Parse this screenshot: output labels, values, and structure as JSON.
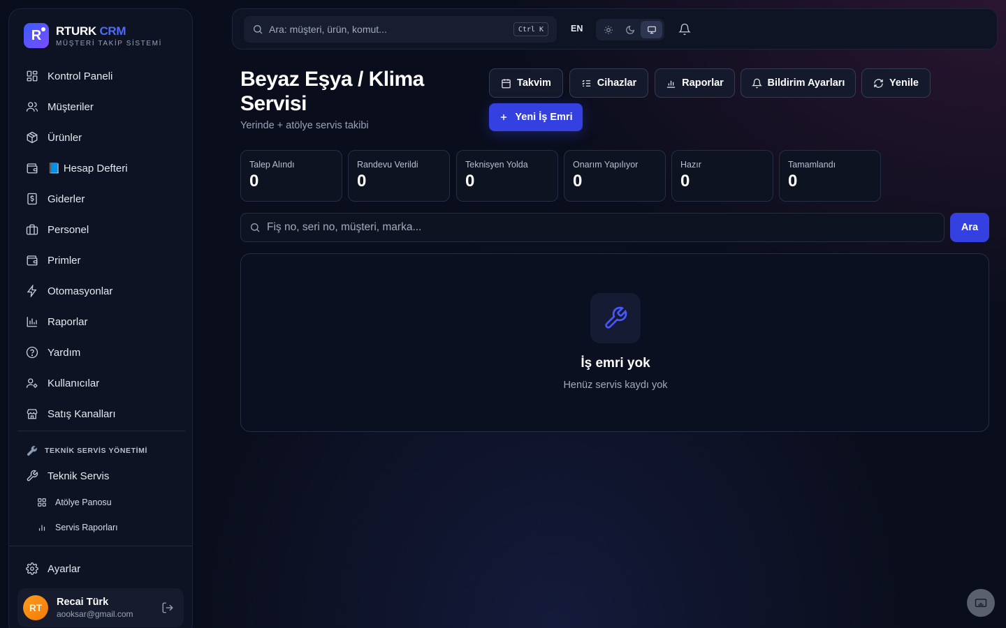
{
  "brand": {
    "title_a": "RTURK",
    "title_b": "CRM",
    "subtitle": "MÜŞTERİ TAKİP SİSTEMİ",
    "logo_letter": "R"
  },
  "sidebar": {
    "items": [
      {
        "label": "Kontrol Paneli",
        "icon": "grid-icon"
      },
      {
        "label": "Müşteriler",
        "icon": "users-icon"
      },
      {
        "label": "Ürünler",
        "icon": "box-icon"
      },
      {
        "label": "📘 Hesap Defteri",
        "icon": "wallet-icon"
      },
      {
        "label": "Giderler",
        "icon": "receipt-icon"
      },
      {
        "label": "Personel",
        "icon": "briefcase-icon"
      },
      {
        "label": "Primler",
        "icon": "wallet-icon"
      },
      {
        "label": "Otomasyonlar",
        "icon": "bolt-icon"
      },
      {
        "label": "Raporlar",
        "icon": "chart-icon"
      },
      {
        "label": "Yardım",
        "icon": "help-icon"
      },
      {
        "label": "Kullanıcılar",
        "icon": "user-cog-icon"
      },
      {
        "label": "Satış Kanalları",
        "icon": "store-icon"
      }
    ],
    "section_label": "TEKNİK SERVİS YÖNETİMİ",
    "section_item": "Teknik Servis",
    "sub_items": [
      {
        "label": "Atölye Panosu"
      },
      {
        "label": "Servis Raporları"
      }
    ],
    "settings": "Ayarlar",
    "user": {
      "initials": "RT",
      "name": "Recai Türk",
      "email": "aooksar@gmail.com"
    }
  },
  "topbar": {
    "search_placeholder": "Ara: müşteri, ürün, komut...",
    "shortcut": "Ctrl K",
    "language": "EN"
  },
  "page": {
    "title": "Beyaz Eşya / Klima Servisi",
    "subtitle": "Yerinde + atölye servis takibi",
    "actions": {
      "calendar": "Takvim",
      "devices": "Cihazlar",
      "reports": "Raporlar",
      "notifications": "Bildirim Ayarları",
      "refresh": "Yenile"
    },
    "new_order": "Yeni İş Emri"
  },
  "stats": [
    {
      "label": "Talep Alındı",
      "value": "0"
    },
    {
      "label": "Randevu Verildi",
      "value": "0"
    },
    {
      "label": "Teknisyen Yolda",
      "value": "0"
    },
    {
      "label": "Onarım Yapılıyor",
      "value": "0"
    },
    {
      "label": "Hazır",
      "value": "0"
    },
    {
      "label": "Tamamlandı",
      "value": "0"
    }
  ],
  "list": {
    "search_placeholder": "Fiş no, seri no, müşteri, marka...",
    "search_button": "Ara",
    "empty_title": "İş emri yok",
    "empty_subtitle": "Henüz servis kaydı yok"
  },
  "colors": {
    "accent": "#3440e0",
    "brand_blue": "#4d6bff",
    "avatar": "#f28a12"
  }
}
